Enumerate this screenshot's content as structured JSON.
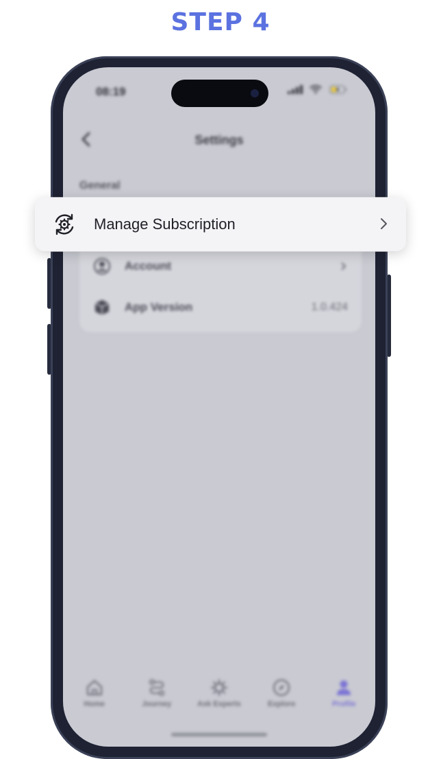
{
  "step": {
    "title": "STEP 4"
  },
  "status_bar": {
    "time": "08:19"
  },
  "nav": {
    "title": "Settings",
    "back_icon": "chevron-left-icon"
  },
  "settings": {
    "section_label": "General",
    "rows": [
      {
        "label": "Account",
        "icon": "user-circle-icon",
        "accessory": "chevron-right-icon"
      },
      {
        "label": "App Version",
        "icon": "cube-icon",
        "value": "1.0.424"
      }
    ]
  },
  "highlight": {
    "label": "Manage Subscription",
    "icon": "gear-sync-icon",
    "accessory": "chevron-right-icon"
  },
  "tabbar": {
    "tabs": [
      {
        "label": "Home",
        "icon": "home-icon"
      },
      {
        "label": "Journey",
        "icon": "route-icon"
      },
      {
        "label": "Ask Experts",
        "icon": "sparkle-gear-icon"
      },
      {
        "label": "Explore",
        "icon": "compass-icon"
      },
      {
        "label": "Profile",
        "icon": "person-icon",
        "active": true
      }
    ]
  },
  "colors": {
    "step_title": "#5b72e0",
    "active_tab": "#7c74d4",
    "screen_bg": "#c9cad2",
    "phone_frame": "#1e2233"
  }
}
